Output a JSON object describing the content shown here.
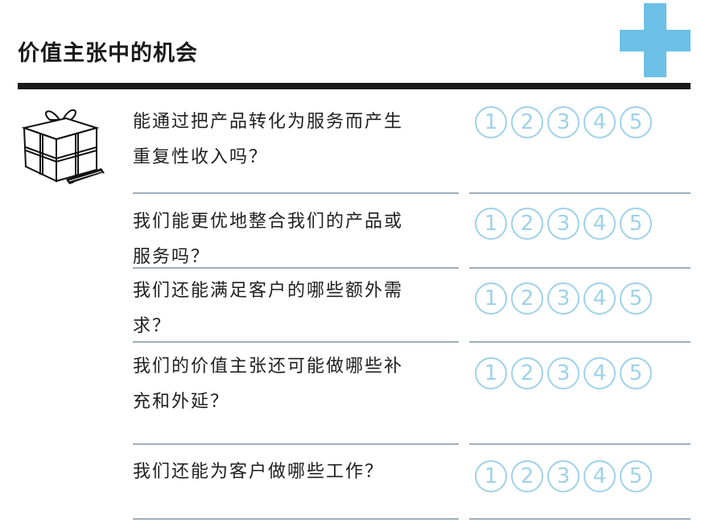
{
  "header": {
    "title": "价值主张中的机会"
  },
  "questions": [
    {
      "line1": "能通过把产品转化为服务而产生",
      "line2": "重复性收入吗？",
      "ratings": [
        "1",
        "2",
        "3",
        "4",
        "5"
      ]
    },
    {
      "line1": "我们能更优地整合我们的产品或",
      "line2": "服务吗？",
      "ratings": [
        "1",
        "2",
        "3",
        "4",
        "5"
      ]
    },
    {
      "line1": "我们还能满足客户的哪些额外需",
      "line2": "求？",
      "ratings": [
        "1",
        "2",
        "3",
        "4",
        "5"
      ]
    },
    {
      "line1": "我们的价值主张还可能做哪些补",
      "line2": "充和外延？",
      "ratings": [
        "1",
        "2",
        "3",
        "4",
        "5"
      ]
    },
    {
      "line1": "我们还能为客户做哪些工作？",
      "line2": "",
      "ratings": [
        "1",
        "2",
        "3",
        "4",
        "5"
      ]
    }
  ],
  "colors": {
    "accent": "#6cc0e6",
    "circle": "#9fd1ea",
    "rule": "#9bb0bc",
    "text": "#1f1f1f"
  },
  "icons": {
    "plus": "plus-icon",
    "gift": "gift-box-icon"
  }
}
